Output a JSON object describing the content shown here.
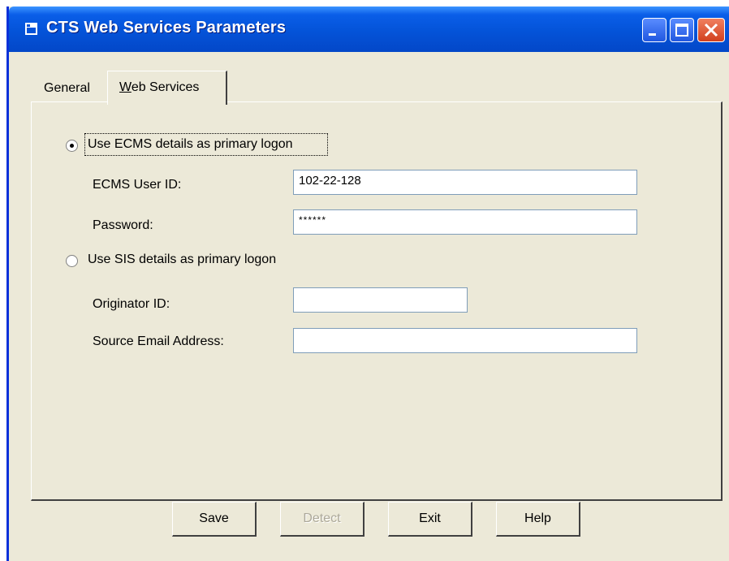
{
  "window": {
    "title": "CTS Web Services Parameters"
  },
  "tabs": [
    {
      "label": "General",
      "active": false
    },
    {
      "label_underlined": "W",
      "label_rest": "eb Services",
      "active": true
    }
  ],
  "options": {
    "ecms": {
      "label": "Use ECMS details as primary logon",
      "selected": true
    },
    "sis": {
      "label": "Use SIS details as primary logon",
      "selected": false
    }
  },
  "fields": {
    "ecms_user_id": {
      "label": "ECMS User ID:",
      "value": "102-22-128"
    },
    "password": {
      "label": "Password:",
      "value": "******"
    },
    "originator_id": {
      "label": "Originator ID:",
      "value": ""
    },
    "source_email": {
      "label": "Source Email Address:",
      "value": ""
    }
  },
  "buttons": {
    "save": "Save",
    "detect": "Detect",
    "exit": "Exit",
    "help": "Help"
  },
  "colors": {
    "titlebar": "#0453d8",
    "window_bg": "#ece9d8",
    "close_button": "#d1401e"
  },
  "icons": {
    "title": "app-window-icon",
    "minimize": "minimize-icon",
    "maximize": "maximize-icon",
    "close": "close-icon"
  }
}
